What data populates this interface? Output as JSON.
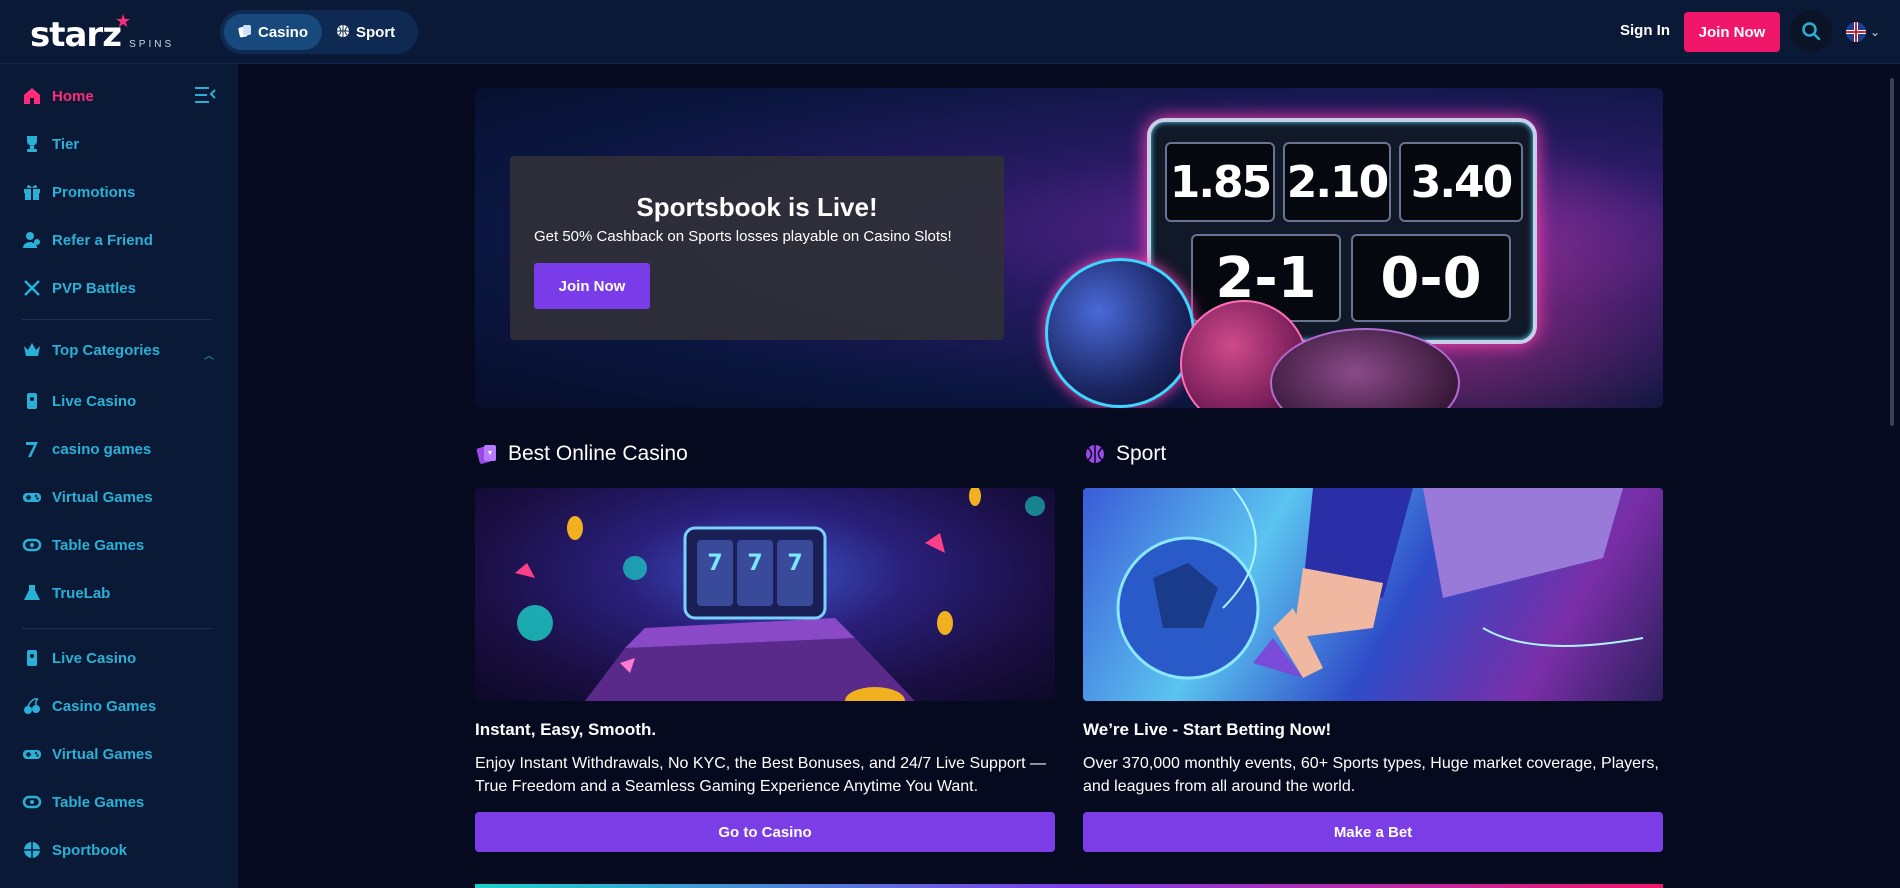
{
  "header": {
    "logo_text": "starz",
    "logo_sub": "SPINS",
    "mode_tabs": [
      {
        "label": "Casino",
        "active": true,
        "icon": "cards-icon"
      },
      {
        "label": "Sport",
        "active": false,
        "icon": "ball-icon"
      }
    ],
    "sign_in": "Sign In",
    "join_now": "Join Now",
    "search_icon": "search-icon",
    "language_icon": "uk-flag-icon"
  },
  "sidebar": {
    "items": [
      {
        "label": "Home",
        "icon": "home-icon",
        "active": true
      },
      {
        "label": "Tier",
        "icon": "trophy-icon"
      },
      {
        "label": "Promotions",
        "icon": "gift-icon"
      },
      {
        "label": "Refer a Friend",
        "icon": "users-icon"
      },
      {
        "label": "PVP Battles",
        "icon": "swords-icon"
      }
    ],
    "top_categories": {
      "label": "Top Categories",
      "icon": "crown-icon",
      "expanded": true,
      "items": [
        {
          "label": "Live Casino",
          "icon": "live-casino-icon"
        },
        {
          "label": "casino games",
          "icon": "seven-icon"
        },
        {
          "label": "Virtual Games",
          "icon": "gamepad-icon"
        },
        {
          "label": "Table Games",
          "icon": "table-icon"
        },
        {
          "label": "TrueLab",
          "icon": "truelab-icon"
        }
      ]
    },
    "more_items": [
      {
        "label": "Live Casino",
        "icon": "live-casino-icon"
      },
      {
        "label": "Casino Games",
        "icon": "cherries-icon"
      },
      {
        "label": "Virtual Games",
        "icon": "gamepad-icon"
      },
      {
        "label": "Table Games",
        "icon": "table-icon"
      },
      {
        "label": "Sportbook",
        "icon": "sportball-icon"
      }
    ]
  },
  "hero": {
    "title": "Sportsbook is Live!",
    "subtitle": "Get 50% Cashback on Sports losses playable on Casino Slots!",
    "button": "Join Now",
    "scoreboard": {
      "odds": [
        "1.85",
        "2.10",
        "3.40"
      ],
      "scores": [
        "2-1",
        "0-0"
      ]
    }
  },
  "sections": {
    "casino": {
      "heading": "Best Online Casino",
      "title": "Instant, Easy, Smooth.",
      "description": "Enjoy Instant Withdrawals, No KYC, the Best Bonuses, and 24/7 Live Support — True Freedom and a Seamless Gaming Experience Anytime You Want.",
      "button": "Go to Casino"
    },
    "sport": {
      "heading": "Sport",
      "title": "We’re Live - Start Betting Now!",
      "description": "Over 370,000 monthly events, 60+ Sports types, Huge market coverage, Players, and leagues from all around the world.",
      "button": "Make a Bet"
    }
  },
  "colors": {
    "accent_pink": "#f0166a",
    "accent_purple": "#7b3ee6",
    "sidebar_text": "#2ab0d6",
    "background": "#050a1e",
    "panel": "#0a1a36"
  }
}
